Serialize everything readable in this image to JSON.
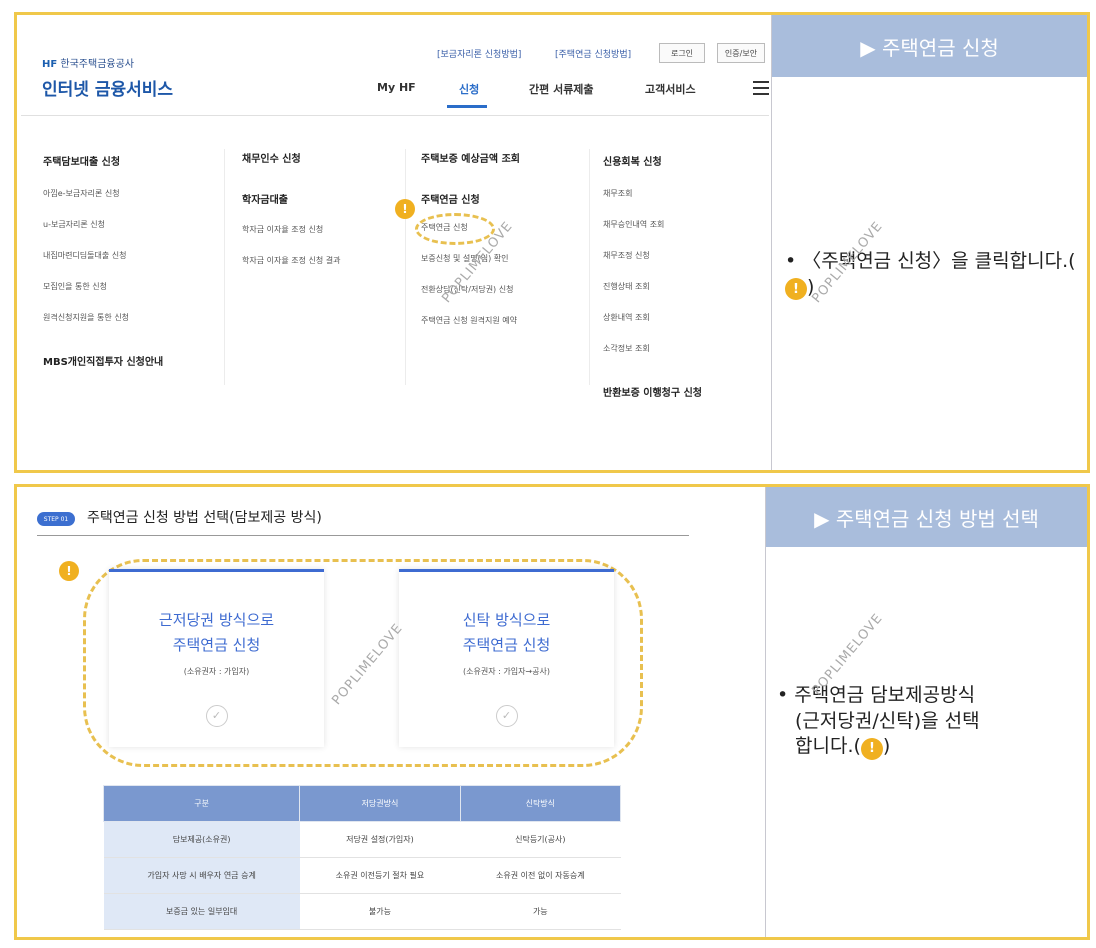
{
  "section1": {
    "logo": {
      "small": "한국주택금융공사",
      "mark": "HF",
      "main": "인터넷 금융서비스"
    },
    "top_links": [
      "[보금자리론 신청방법]",
      "[주택연금 신청방법]"
    ],
    "top_buttons": [
      "로그인",
      "인증/보안"
    ],
    "nav": [
      "My HF",
      "신청",
      "간편 서류제출",
      "고객서비스"
    ],
    "menu": {
      "col1": {
        "head": "주택담보대출 신청",
        "items": [
          "아낌e-보금자리론 신청",
          "u-보금자리론 신청",
          "내집마련디딤돌대출 신청",
          "모집인을 통한 신청",
          "원격신청지원을 통한 신청"
        ],
        "head2": "MBS개인직접투자 신청안내"
      },
      "col2": {
        "head": "채무인수 신청",
        "head2": "학자금대출",
        "items": [
          "학자금 이자율 조정 신청",
          "학자금 이자율 조정 신청 결과"
        ]
      },
      "col3": {
        "head": "주택보증 예상금액 조회",
        "head2": "주택연금 신청",
        "items": [
          "주택연금 신청",
          "보증신청 및 설명(임) 확인",
          "전환상담(신탁/저당권) 신청",
          "주택연금 신청 원격지원 예약"
        ]
      },
      "col4": {
        "head": "신용회복 신청",
        "items": [
          "채무조회",
          "채무승인내역 조회",
          "채무조정 신청",
          "진행상태 조회",
          "상환내역 조회",
          "소각정보 조회"
        ],
        "head2": "반환보증 이행청구 신청"
      }
    },
    "side_heading": "▶ 주택연금 신청",
    "side_text": "• 〈주택연금 신청〉을 클릭합니다.(",
    "side_text_end": ")",
    "badge": "!"
  },
  "section2": {
    "step_pill": "STEP 01",
    "title": "주택연금 신청 방법 선택(담보제공 방식)",
    "cards": [
      {
        "line1": "근저당권 방식으로",
        "line2": "주택연금 신청",
        "sub": "(소유권자 : 가입자)"
      },
      {
        "line1": "신탁 방식으로",
        "line2": "주택연금 신청",
        "sub": "(소유권자 : 가입자→공사)"
      }
    ],
    "table": {
      "headers": [
        "구분",
        "저당권방식",
        "신탁방식"
      ],
      "rows": [
        [
          "담보제공(소유권)",
          "저당권 설정(가입자)",
          "신탁등기(공사)"
        ],
        [
          "가입자 사망 시 배우자 연금 승계",
          "소유권 이전등기 절차 필요",
          "소유권 이전 없이 자동승계"
        ],
        [
          "보증금 있는 일부임대",
          "불가능",
          "가능"
        ]
      ]
    },
    "side_heading": "▶ 주택연금 신청 방법 선택",
    "side_line1": "• 주택연금 담보제공방식",
    "side_line2": "(근저당권/신탁)을 선택",
    "side_line3": "합니다.(",
    "side_line3_end": ")",
    "badge": "!"
  },
  "watermark": "POPLIMELOVE",
  "colors": {
    "frame": "#f0c84a",
    "side_heading_bg": "#a9bddc",
    "accent_blue": "#3e6bd1",
    "badge": "#f0b020"
  }
}
